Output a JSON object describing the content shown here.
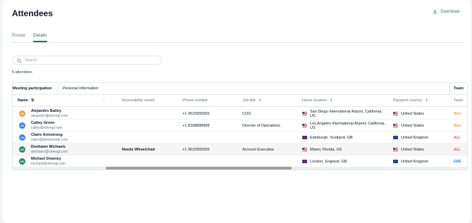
{
  "header": {
    "title": "Attendees",
    "download_label": "Download"
  },
  "tabs": [
    {
      "label": "Roster",
      "active": false
    },
    {
      "label": "Details",
      "active": true
    }
  ],
  "search": {
    "placeholder": "Search",
    "value": ""
  },
  "attendee_count": "5 attendees",
  "groups": {
    "participation": "Meeting participation",
    "personal": "Personal information",
    "team": "Team"
  },
  "columns": {
    "name": "Name",
    "accessibility": "Accessibility needs",
    "phone": "Phone number",
    "job": "Job title",
    "home": "Home location",
    "passport": "Passport country",
    "team": "Team"
  },
  "rows": [
    {
      "initials": "AB",
      "avatar_color": "#f59e42",
      "name": "Alejandro Bailey",
      "email": "alejandro@strivegl.com",
      "accessibility": "",
      "phone": "+1 9515555555",
      "job": "COO",
      "home": "San Diego International Airport, California, US",
      "home_flag": "us",
      "passport": "United States",
      "passport_flag": "us",
      "team": "Wes",
      "team_color": "#e9a13b"
    },
    {
      "initials": "CG",
      "avatar_color": "#3b82f6",
      "name": "Cailey Green",
      "email": "cailey@strivegl.com",
      "accessibility": "",
      "phone": "+1 8188888888",
      "job": "Director of Operations",
      "home": "Los Angeles International Airport, California, US",
      "home_flag": "us",
      "passport": "United States",
      "passport_flag": "us",
      "team": "Wes",
      "team_color": "#e9a13b"
    },
    {
      "initials": "CA",
      "avatar_color": "#3b82f6",
      "name": "Claire Armstrong",
      "email": "claire@dentonsedi.com",
      "accessibility": "",
      "phone": "",
      "job": "",
      "home": "Edinburgh, Scotland, GB",
      "home_flag": "uk",
      "passport": "United Kingdom",
      "passport_flag": "uk",
      "team": "ALL",
      "team_color": "#e05252"
    },
    {
      "initials": "DM",
      "avatar_color": "#1f8a5b",
      "name": "Deshawn Michaels",
      "email": "deshawn@strivegl.com",
      "accessibility": "Needs Wheelchair",
      "phone": "+1 9515555555",
      "job": "Account Executive",
      "home": "Miami, Florida, US",
      "home_flag": "us",
      "passport": "United States",
      "passport_flag": "us",
      "team": "ALL",
      "team_color": "#e05252"
    },
    {
      "initials": "MD",
      "avatar_color": "#1f8a5b",
      "name": "Michael Downey",
      "email": "michael@strivegl.com",
      "accessibility": "",
      "phone": "",
      "job": "",
      "home": "London, England, GB",
      "home_flag": "uk",
      "passport": "United Kingdom",
      "passport_flag": "uk",
      "team": "EME",
      "team_color": "#3b82f6"
    }
  ]
}
